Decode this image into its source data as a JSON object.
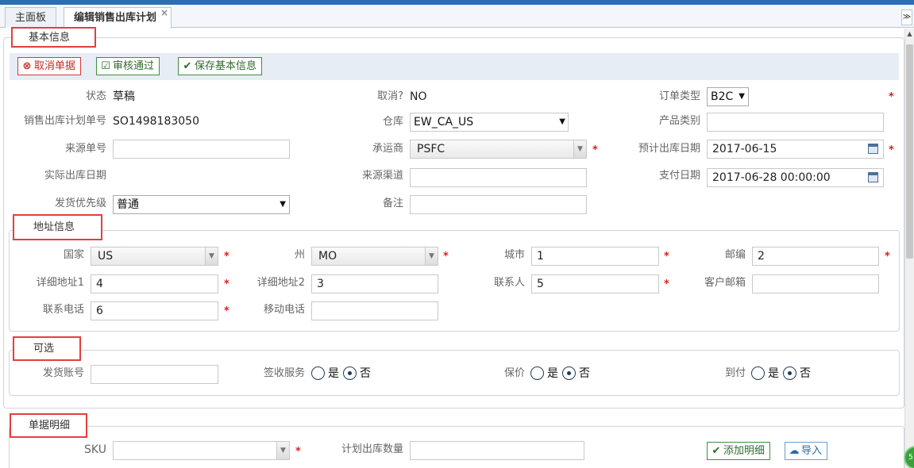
{
  "tabs": [
    {
      "label": "主面板"
    },
    {
      "label": "编辑销售出库计划",
      "close": "×"
    }
  ],
  "tab_menu": "≫",
  "sections": {
    "basic": "基本信息",
    "address": "地址信息",
    "optional": "可选",
    "detail": "单据明细"
  },
  "toolbar": {
    "cancel": "取消单据",
    "approve": "审核通过",
    "save": "保存基本信息"
  },
  "basic": {
    "status_label": "状态",
    "status_value": "草稿",
    "cancelled_label": "取消?",
    "cancelled_value": "NO",
    "order_type_label": "订单类型",
    "order_type_value": "B2C",
    "plan_no_label": "销售出库计划单号",
    "plan_no_value": "SO1498183050",
    "warehouse_label": "仓库",
    "warehouse_value": "EW_CA_US",
    "product_cat_label": "产品类别",
    "product_cat_value": "",
    "source_no_label": "来源单号",
    "source_no_value": "",
    "carrier_label": "承运商",
    "carrier_value": "PSFC",
    "est_date_label": "预计出库日期",
    "est_date_value": "2017-06-15",
    "actual_date_label": "实际出库日期",
    "channel_label": "来源渠道",
    "channel_value": "",
    "pay_date_label": "支付日期",
    "pay_date_value": "2017-06-28 00:00:00",
    "priority_label": "发货优先级",
    "priority_value": "普通",
    "remark_label": "备注",
    "remark_value": ""
  },
  "address": {
    "country_label": "国家",
    "country_value": "US",
    "state_label": "州",
    "state_value": "MO",
    "city_label": "城市",
    "city_value": "1",
    "zip_label": "邮编",
    "zip_value": "2",
    "addr1_label": "详细地址1",
    "addr1_value": "4",
    "addr2_label": "详细地址2",
    "addr2_value": "3",
    "contact_label": "联系人",
    "contact_value": "5",
    "email_label": "客户邮箱",
    "email_value": "",
    "phone_label": "联系电话",
    "phone_value": "6",
    "mobile_label": "移动电话",
    "mobile_value": ""
  },
  "optional": {
    "account_label": "发货账号",
    "account_value": "",
    "sign_label": "签收服务",
    "insure_label": "保价",
    "cod_label": "到付",
    "yes": "是",
    "no": "否",
    "sign_selected": "否",
    "insure_selected": "否",
    "cod_selected": "否"
  },
  "detail": {
    "sku_label": "SKU",
    "sku_value": "",
    "qty_label": "计划出库数量",
    "qty_value": "",
    "add_button": "添加明细",
    "import_button": "导入"
  },
  "required_mark": "*",
  "colors": {
    "accent": "#2a6fb6",
    "required": "#d62020",
    "legend_border": "#e43f3f",
    "toolbar_bg": "#e6edf5"
  }
}
